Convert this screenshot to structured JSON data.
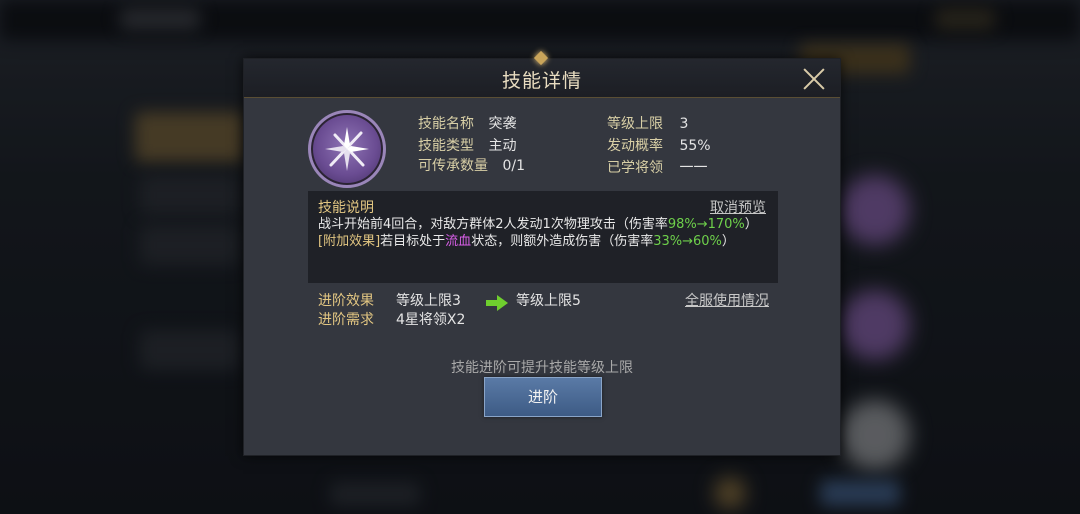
{
  "dialog": {
    "title": "技能详情",
    "close_icon": "close-icon"
  },
  "skill": {
    "icon": "crossed-swords-icon",
    "name_label": "技能名称",
    "name_value": "突袭",
    "type_label": "技能类型",
    "type_value": "主动",
    "inherit_label": "可传承数量",
    "inherit_value": "0/1",
    "level_cap_label": "等级上限",
    "level_cap_value": "3",
    "trigger_label": "发动概率",
    "trigger_value": "55%",
    "learned_label": "已学将领",
    "learned_value": "一一"
  },
  "description": {
    "title": "技能说明",
    "cancel_preview": "取消预览",
    "line1_prefix": "战斗开始前4回合，对敌方群体2人发动1次物理攻击（伤害率",
    "line1_rate": "98%→170%",
    "line1_suffix": "）",
    "extra_tag": "[附加效果]",
    "line2_prefix": "若目标处于",
    "line2_status": "流血",
    "line2_mid": "状态，则额外造成伤害（伤害率",
    "line2_rate": "33%→60%",
    "line2_suffix": "）"
  },
  "advance": {
    "effect_label": "进阶效果",
    "effect_from": "等级上限3",
    "effect_to": "等级上限5",
    "req_label": "进阶需求",
    "req_value": "4星将领X2",
    "server_usage": "全服使用情况",
    "hint": "技能进阶可提升技能等级上限",
    "button": "进阶"
  },
  "nav": {
    "prev_icon": "chevron-left-icon",
    "next_icon": "chevron-right-icon"
  },
  "colors": {
    "accent_gold": "#e2c682",
    "highlight_green": "#6ed04b",
    "status_magenta": "#d95fe8",
    "button_blue": "#4a6a96"
  }
}
